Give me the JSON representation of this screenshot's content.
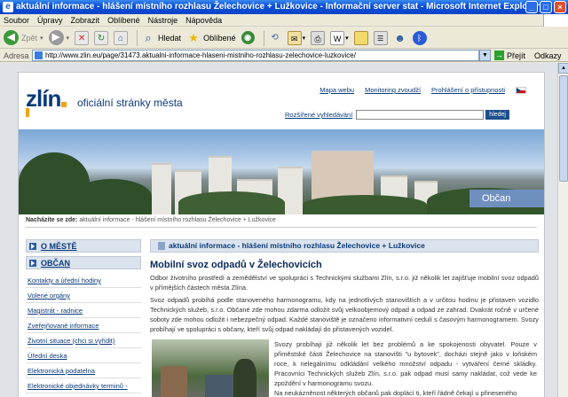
{
  "window": {
    "title": "aktuální informace - hlášení místního rozhlasu Želechovice + Lužkovice - Informační server stat - Microsoft Internet Explorer"
  },
  "menu": [
    "Soubor",
    "Úpravy",
    "Zobrazit",
    "Oblíbené",
    "Nástroje",
    "Nápověda"
  ],
  "toolbar": {
    "back_label": "Zpět",
    "search_label": "Hledat",
    "favorites_label": "Oblíbené"
  },
  "address": {
    "label": "Adresa",
    "url": "http://www.zlin.eu/page/31473.aktualni-informace-hlaseni-mistniho-rozhlasu-zelechovice-luzkovice/",
    "go_label": "Přejít",
    "links_label": "Odkazy"
  },
  "site": {
    "logo": "zlín",
    "tagline": "oficiální stránky města",
    "top_links": [
      "Mapa webu",
      "Monitoring zvoudží",
      "Prohlášení o přístupnosti"
    ],
    "search_label": "Rozšířené vyhledávání",
    "search_button": "hledej",
    "banner_label": "Občan"
  },
  "breadcrumb": {
    "prefix": "Nacházíte se zde:",
    "path": "aktuální informace - hlášení místního rozhlasu Želechovice + Lužkovice"
  },
  "leftnav": {
    "heading_1": "O MĚSTĚ",
    "heading_2": "OBČAN",
    "items": [
      "Kontakty a úřední hodiny",
      "Volené orgány",
      "Magistrát - radnice",
      "Zveřejňované informace",
      "Životní situace (chci si vyřídit)",
      "Úřední deska",
      "Elektronická podatelna",
      "Elektronické objednávky terminů -"
    ]
  },
  "main": {
    "bar_title": "aktuální informace - hlášení místního rozhlasu Želechovice + Lužkovice",
    "title": "Mobilní svoz odpadů v Želechovicích",
    "para1": "Odbor životního prostředí a zemědělství ve spolupráci s Technickými službami Zlín, s.r.o. již několik let zajišťuje mobilní svoz odpadů v přímějších částech města Zlína.",
    "para2": "Svoz odpadů probíhá podle stanoveného harmonogramu, kdy na jednotlivých stanovištích a v určitou hodinu je přistaven vozidlo Technických služeb, s.r.o. Občané zde mohou zdarma odložit svůj velkoobjemový odpad a odpad ze zahrad. Dvakrát ročně v určené soboty zde mohou odložit i nebezpečný odpad. Každé stanoviště je označeno informativní cedulí s časovým harmonogramem. Svozy probíhají ve spolupráci s občany, kteří svůj odpad nakládají do přistavených vozidel.",
    "para3": "Svozy probíhají již několik let bez problémů a ke spokojenosti obyvatel. Pouze v přiměstské části Želechovice na stanovišti \"u bytovek\", docházi stejně jako v loňském roce, k nelegálnímu odkládání velkého množství odpadu - vytváření černé skládky. Pracovníci Technických služeb Zlín, s.r.o. pak odpad musí samy nakládat, což vede ke zpoždění v harmonogramu svozu.",
    "para4": "Na neukázněnost některých občanů pak doplácí ti, kteří řádně čekají u přineseného"
  }
}
